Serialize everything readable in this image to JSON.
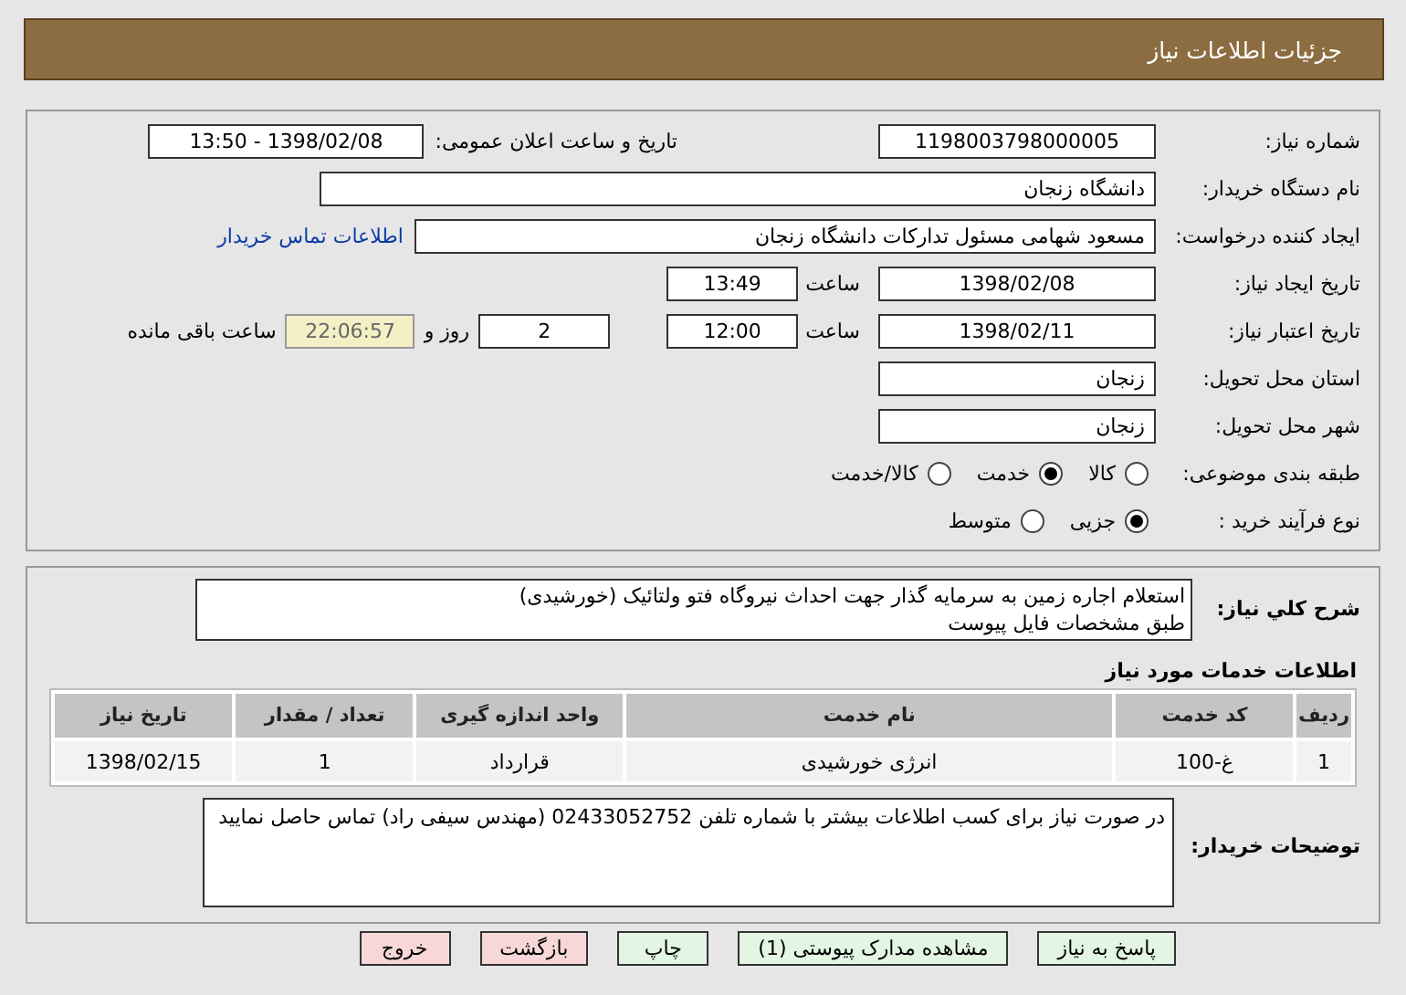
{
  "header": {
    "title": "جزئیات اطلاعات نیاز"
  },
  "details": {
    "need_number": {
      "label": "شماره نیاز:",
      "value": "1198003798000005"
    },
    "announce": {
      "label": "تاریخ و ساعت اعلان عمومی:",
      "value": "1398/02/08 - 13:50"
    },
    "buyer": {
      "label": "نام دستگاه خریدار:",
      "value": "دانشگاه زنجان"
    },
    "requester": {
      "label": "ایجاد کننده درخواست:",
      "value": "مسعود شهامی مسئول تدارکات دانشگاه زنجان",
      "link": "اطلاعات تماس خریدار"
    },
    "creation": {
      "label": "تاریخ ایجاد نیاز:",
      "date": "1398/02/08",
      "time_label": "ساعت",
      "time": "13:49"
    },
    "validity": {
      "label": "تاریخ اعتبار نیاز:",
      "date": "1398/02/11",
      "time_label": "ساعت",
      "time": "12:00",
      "days": "2",
      "days_label": "روز و",
      "remaining": "22:06:57",
      "remaining_label": "ساعت باقی مانده"
    },
    "province": {
      "label": "استان محل تحویل:",
      "value": "زنجان"
    },
    "city": {
      "label": "شهر محل تحویل:",
      "value": "زنجان"
    },
    "category": {
      "label": "طبقه بندی موضوعی:",
      "options": [
        {
          "label": "کالا",
          "selected": false
        },
        {
          "label": "خدمت",
          "selected": true
        },
        {
          "label": "کالا/خدمت",
          "selected": false
        }
      ]
    },
    "process": {
      "label": "نوع فرآیند خرید :",
      "options": [
        {
          "label": "جزیی",
          "selected": true
        },
        {
          "label": "متوسط",
          "selected": false
        }
      ]
    }
  },
  "summary": {
    "label": "شرح كلي نياز:",
    "lines": [
      "استعلام اجاره زمین به سرمایه گذار جهت احداث نیروگاه فتو ولتائیک (خورشیدی)",
      "طبق مشخصات فایل پیوست"
    ]
  },
  "services": {
    "title": "اطلاعات خدمات مورد نیاز",
    "columns": [
      "ردیف",
      "کد خدمت",
      "نام خدمت",
      "واحد اندازه گیری",
      "تعداد / مقدار",
      "تاریخ نیاز"
    ],
    "rows": [
      [
        "1",
        "غ-100",
        "انرژی خورشیدی",
        "قرارداد",
        "1",
        "1398/02/15"
      ]
    ]
  },
  "buyer_notes": {
    "label": "توضیحات خریدار:",
    "text": "در صورت نیاز برای کسب اطلاعات بیشتر با شماره تلفن 02433052752 (مهندس سیفی راد) تماس حاصل نمایید"
  },
  "buttons": [
    {
      "label": "پاسخ به نیاز",
      "kind": "normal"
    },
    {
      "label": "مشاهده مدارک پیوستی (1)",
      "kind": "normal"
    },
    {
      "label": "چاپ",
      "kind": "normal"
    },
    {
      "label": "بازگشت",
      "kind": "danger"
    },
    {
      "label": "خروج",
      "kind": "danger"
    }
  ]
}
